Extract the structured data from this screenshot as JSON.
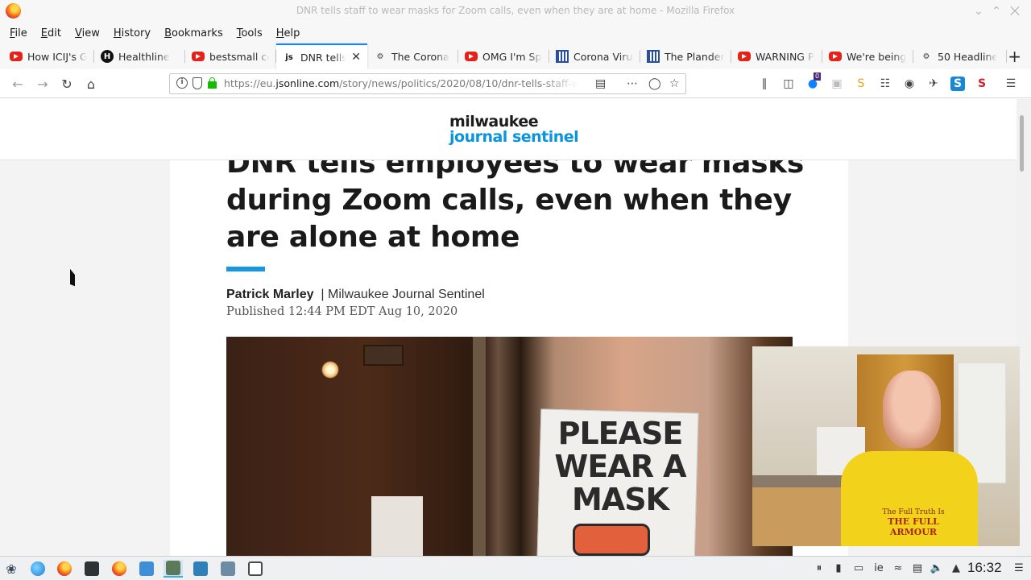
{
  "window": {
    "title": "DNR tells staff to wear masks for Zoom calls, even when they are at home - Mozilla Firefox"
  },
  "menu": [
    "File",
    "Edit",
    "View",
    "History",
    "Bookmarks",
    "Tools",
    "Help"
  ],
  "tabs": [
    {
      "label": "How ICIJ's G",
      "icon": "youtube-icon"
    },
    {
      "label": "Healthline",
      "icon": "healthline-icon"
    },
    {
      "label": "bestsmall co",
      "icon": "youtube-icon"
    },
    {
      "label": "DNR tells",
      "icon": "jsonline-icon",
      "active": true
    },
    {
      "label": "The Corona",
      "icon": "gear-icon"
    },
    {
      "label": "OMG I'm Spe",
      "icon": "youtube-icon"
    },
    {
      "label": "Corona Virus",
      "icon": "grid-icon"
    },
    {
      "label": "The Planden",
      "icon": "grid-icon"
    },
    {
      "label": "WARNING P",
      "icon": "youtube-icon"
    },
    {
      "label": "We're being",
      "icon": "youtube-icon"
    },
    {
      "label": "50 Headline",
      "icon": "gear-icon"
    }
  ],
  "nav": {
    "url_prefix": "https://eu.",
    "url_domain": "jsonline.com",
    "url_path": "/story/news/politics/2020/08/10/dnr-tells-staff-we",
    "notification_count": "0"
  },
  "page": {
    "masthead_line1": "milwaukee",
    "masthead_line2": "journal sentinel",
    "headline": "DNR tells employees to wear masks during Zoom calls, even when they are alone at home",
    "author": "Patrick Marley",
    "outlet": "| Milwaukee Journal Sentinel",
    "published": "Published 12:44 PM EDT Aug 10, 2020",
    "photo_sign": "PLEASE WEAR A MASK"
  },
  "webcam": {
    "shirt_line1": "The Full Truth Is",
    "shirt_line2": "THE FULL ARMOUR"
  },
  "taskbar": {
    "keyboard_layout": "ie",
    "clock": "16:32"
  }
}
